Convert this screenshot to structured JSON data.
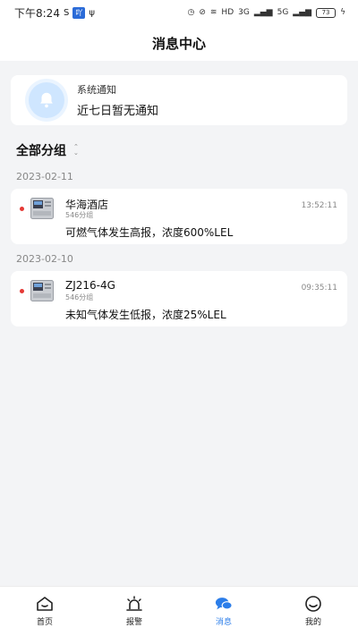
{
  "status_bar": {
    "time": "下午8:24",
    "app_badge": "吖",
    "network": "HD",
    "signal_1": "3G",
    "signal_2": "5G",
    "battery": "73"
  },
  "header": {
    "title": "消息中心"
  },
  "system_notice": {
    "title": "系统通知",
    "message": "近七日暂无通知"
  },
  "group_filter": {
    "label": "全部分组"
  },
  "sections": [
    {
      "date": "2023-02-11",
      "item": {
        "name": "华海酒店",
        "group": "546分组",
        "time": "13:52:11",
        "message": "可燃气体发生高报，浓度600%LEL"
      }
    },
    {
      "date": "2023-02-10",
      "item": {
        "name": "ZJ216-4G",
        "group": "546分组",
        "time": "09:35:11",
        "message": "未知气体发生低报，浓度25%LEL"
      }
    }
  ],
  "tabs": [
    {
      "label": "首页",
      "icon": "home-icon"
    },
    {
      "label": "报警",
      "icon": "alarm-icon"
    },
    {
      "label": "消息",
      "icon": "message-icon",
      "active": true
    },
    {
      "label": "我的",
      "icon": "profile-icon"
    }
  ],
  "colors": {
    "accent": "#2b7de9",
    "alarm_dot": "#e53935",
    "background": "#f3f4f6"
  }
}
